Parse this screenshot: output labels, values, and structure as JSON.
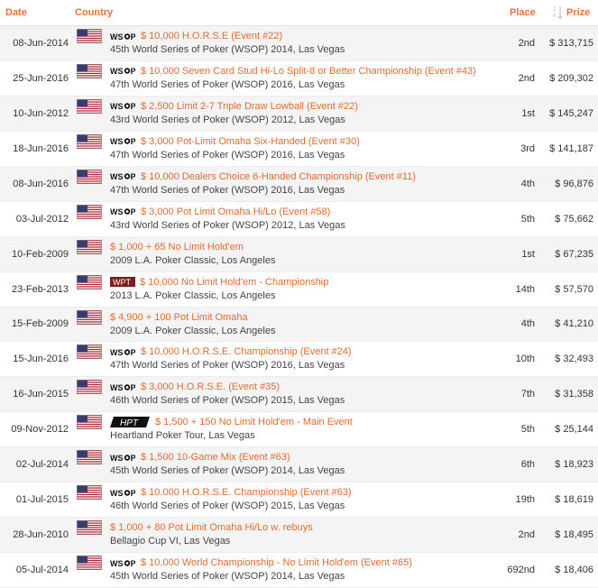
{
  "header": {
    "date": "Date",
    "country": "Country",
    "place": "Place",
    "prize": "Prize"
  },
  "rows": [
    {
      "date": "08-Jun-2014",
      "logo": "WSOP",
      "event": "$ 10,000 H.O.R.S.E (Event #22)",
      "series": "45th World Series of Poker (WSOP) 2014, Las Vegas",
      "place": "2nd",
      "prize": "$ 313,715"
    },
    {
      "date": "25-Jun-2016",
      "logo": "WSOP",
      "event": "$ 10,000 Seven Card Stud Hi-Lo Split-8 or Better Championship (Event #43)",
      "series": "47th World Series of Poker (WSOP) 2016, Las Vegas",
      "place": "2nd",
      "prize": "$ 209,302"
    },
    {
      "date": "10-Jun-2012",
      "logo": "WSOP",
      "event": "$ 2,500 Limit 2-7 Triple Draw Lowball (Event #22)",
      "series": "43rd World Series of Poker (WSOP) 2012, Las Vegas",
      "place": "1st",
      "prize": "$ 145,247"
    },
    {
      "date": "18-Jun-2016",
      "logo": "WSOP",
      "event": "$ 3,000 Pot-Limit Omaha Six-Handed (Event #30)",
      "series": "47th World Series of Poker (WSOP) 2016, Las Vegas",
      "place": "3rd",
      "prize": "$ 141,187"
    },
    {
      "date": "08-Jun-2016",
      "logo": "WSOP",
      "event": "$ 10,000 Dealers Choice 6-Handed Championship (Event #11)",
      "series": "47th World Series of Poker (WSOP) 2016, Las Vegas",
      "place": "4th",
      "prize": "$ 96,876"
    },
    {
      "date": "03-Jul-2012",
      "logo": "WSOP",
      "event": "$ 3,000 Pot Limit Omaha Hi/Lo (Event #58)",
      "series": "43rd World Series of Poker (WSOP) 2012, Las Vegas",
      "place": "5th",
      "prize": "$ 75,662"
    },
    {
      "date": "10-Feb-2009",
      "logo": "",
      "event": "$ 1,000 + 65 No Limit Hold'em",
      "series": "2009 L.A. Poker Classic, Los Angeles",
      "place": "1st",
      "prize": "$ 67,235"
    },
    {
      "date": "23-Feb-2013",
      "logo": "WPT",
      "event": "$ 10,000 No Limit Hold'em - Championship",
      "series": "2013 L.A. Poker Classic, Los Angeles",
      "place": "14th",
      "prize": "$ 57,570"
    },
    {
      "date": "15-Feb-2009",
      "logo": "",
      "event": "$ 4,900 + 100 Pot Limit Omaha",
      "series": "2009 L.A. Poker Classic, Los Angeles",
      "place": "4th",
      "prize": "$ 41,210"
    },
    {
      "date": "15-Jun-2016",
      "logo": "WSOP",
      "event": "$ 10,000 H.O.R.S.E. Championship (Event #24)",
      "series": "47th World Series of Poker (WSOP) 2016, Las Vegas",
      "place": "10th",
      "prize": "$ 32,493"
    },
    {
      "date": "16-Jun-2015",
      "logo": "WSOP",
      "event": "$ 3,000 H.O.R.S.E. (Event #35)",
      "series": "46th World Series of Poker (WSOP) 2015, Las Vegas",
      "place": "7th",
      "prize": "$ 31,358"
    },
    {
      "date": "09-Nov-2012",
      "logo": "HPT",
      "event": "$ 1,500 + 150 No Limit Hold'em - Main Event",
      "series": "Heartland Poker Tour, Las Vegas",
      "place": "5th",
      "prize": "$ 25,144"
    },
    {
      "date": "02-Jul-2014",
      "logo": "WSOP",
      "event": "$ 1,500 10-Game Mix (Event #63)",
      "series": "45th World Series of Poker (WSOP) 2014, Las Vegas",
      "place": "6th",
      "prize": "$ 18,923"
    },
    {
      "date": "01-Jul-2015",
      "logo": "WSOP",
      "event": "$ 10,000 H.O.R.S.E. Championship (Event #63)",
      "series": "46th World Series of Poker (WSOP) 2015, Las Vegas",
      "place": "19th",
      "prize": "$ 18,619"
    },
    {
      "date": "28-Jun-2010",
      "logo": "",
      "event": "$ 1,000 + 80 Pot Limit Omaha Hi/Lo w. rebuys",
      "series": "Bellagio Cup VI, Las Vegas",
      "place": "2nd",
      "prize": "$ 18,495"
    },
    {
      "date": "05-Jul-2014",
      "logo": "WSOP",
      "event": "$ 10,000 World Championship - No Limit Hold'em (Event #65)",
      "series": "45th World Series of Poker (WSOP) 2014, Las Vegas",
      "place": "692nd",
      "prize": "$ 18,406"
    }
  ],
  "colors": {
    "accent": "#e8723a",
    "link": "#e06a2f",
    "zebra": "#f4f4f4"
  },
  "icons": {
    "flag": "us-flag-icon",
    "sort": "sort-az-icon"
  }
}
